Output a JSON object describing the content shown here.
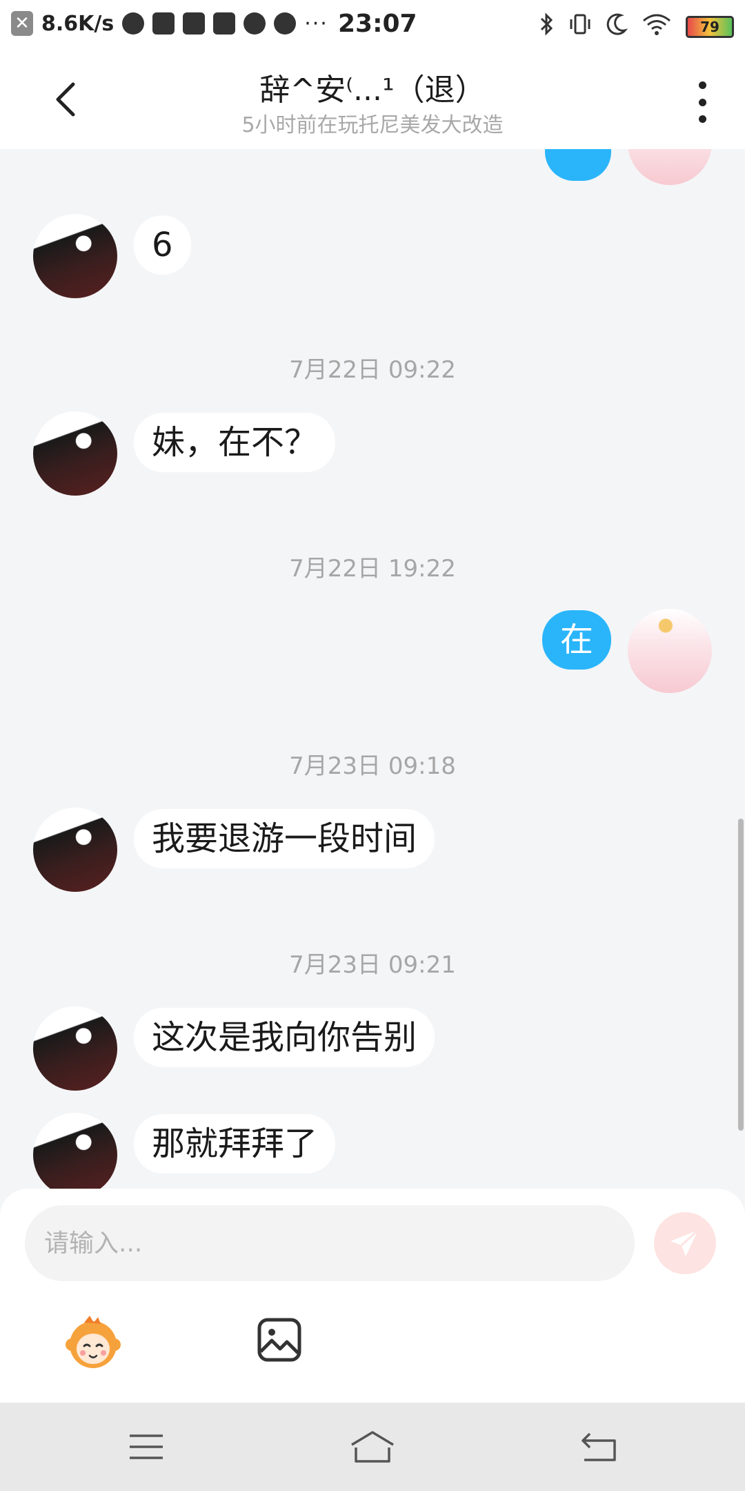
{
  "status_bar": {
    "net_speed": "8.6K/s",
    "time": "23:07",
    "battery": "79",
    "overflow": "···"
  },
  "header": {
    "title": "辞^安⁽...¹（退）",
    "subtitle": "5小时前在玩托尼美发大改造"
  },
  "messages": [
    {
      "type": "text",
      "side": "left",
      "text": "6"
    },
    {
      "type": "time",
      "text": "7月22日 09:22"
    },
    {
      "type": "text",
      "side": "left",
      "text": "妹，在不？"
    },
    {
      "type": "time",
      "text": "7月22日 19:22"
    },
    {
      "type": "text",
      "side": "right",
      "text": "在"
    },
    {
      "type": "time",
      "text": "7月23日 09:18"
    },
    {
      "type": "text",
      "side": "left",
      "text": "我要退游一段时间"
    },
    {
      "type": "time",
      "text": "7月23日 09:21"
    },
    {
      "type": "text",
      "side": "left",
      "text": "这次是我向你告别"
    },
    {
      "type": "text",
      "side": "left",
      "text": "那就拜拜了"
    }
  ],
  "input": {
    "placeholder": "请输入..."
  },
  "colors": {
    "accent": "#2ab5fb",
    "send_button": "#fde3e1"
  },
  "icons": {
    "back": "chevron-left-icon",
    "more": "more-vertical-icon",
    "send": "paper-plane-icon",
    "emoji": "monkey-emoji-icon",
    "image": "image-icon"
  }
}
